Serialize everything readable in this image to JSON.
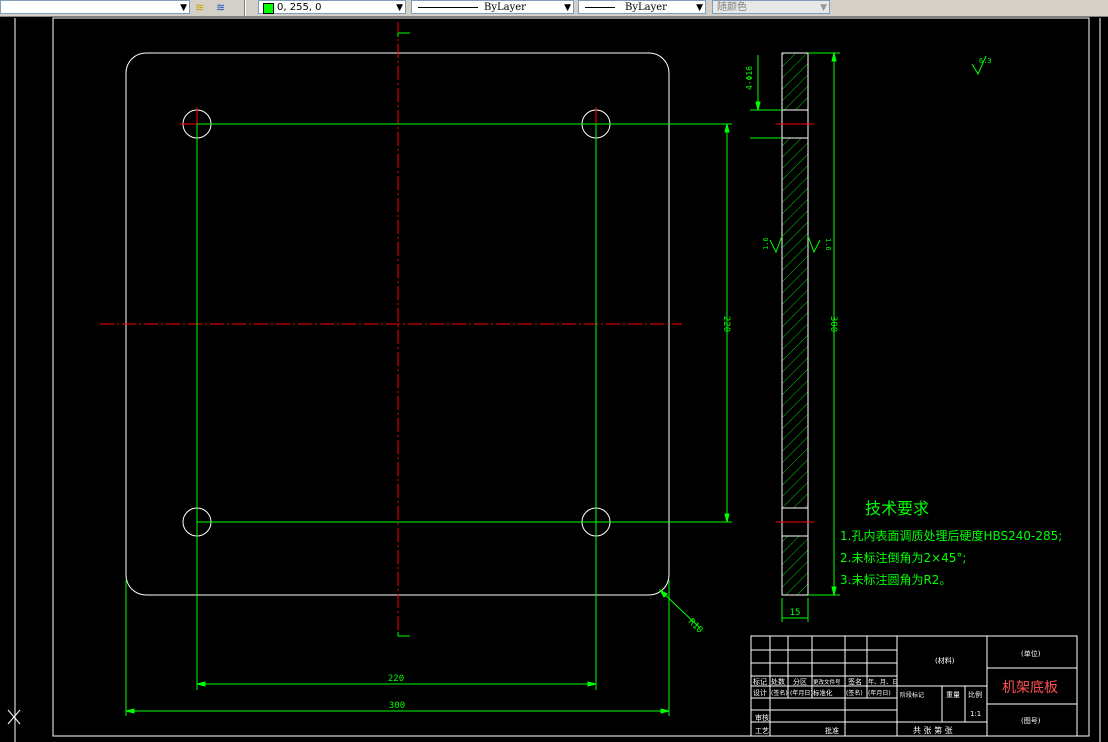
{
  "toolbar": {
    "layer_dropdown": "",
    "color_value": "0, 255, 0",
    "linetype_value": "ByLayer",
    "lineweight_value": "ByLayer",
    "plotstyle_value": "随颜色"
  },
  "drawing": {
    "dims": {
      "width_300": "300",
      "hole_spacing_220_h": "220",
      "height_300": "300",
      "hole_spacing_220_v": "220",
      "radius": "R10",
      "thickness_15": "15",
      "hole_dia": "4-Φ16",
      "roughness_1": "6.3",
      "roughness_2": "1.6",
      "roughness_3": "1.6"
    },
    "tech_req": {
      "title": "技术要求",
      "line1": "1.孔内表面调质处理后硬度HBS240-285;",
      "line2": "2.未标注倒角为2×45°;",
      "line3": "3.未标注圆角为R2。"
    },
    "title_block": {
      "part_name": "机架底板",
      "material_label": "(材料)",
      "school_label": "(单位)",
      "drawing_no_label": "(图号)",
      "row_labels": [
        "标记",
        "处数",
        "分区",
        "更改文件号",
        "签名",
        "年、月、日"
      ],
      "design_labels": [
        "设计",
        "(签名)",
        "(年月日)",
        "标准化",
        "(签名)",
        "(年月日)"
      ],
      "review_label": "审核",
      "process_label": "工艺",
      "approve_label": "批准",
      "stage_label": "阶段标记",
      "weight_label": "重量",
      "scale_label": "比例",
      "scale_value": "1:1",
      "sheets_label": "共 张 第 张"
    }
  },
  "colors": {
    "accent_green": "#00ff00",
    "outline_white": "#ffffff",
    "center_red": "#ff0000"
  }
}
